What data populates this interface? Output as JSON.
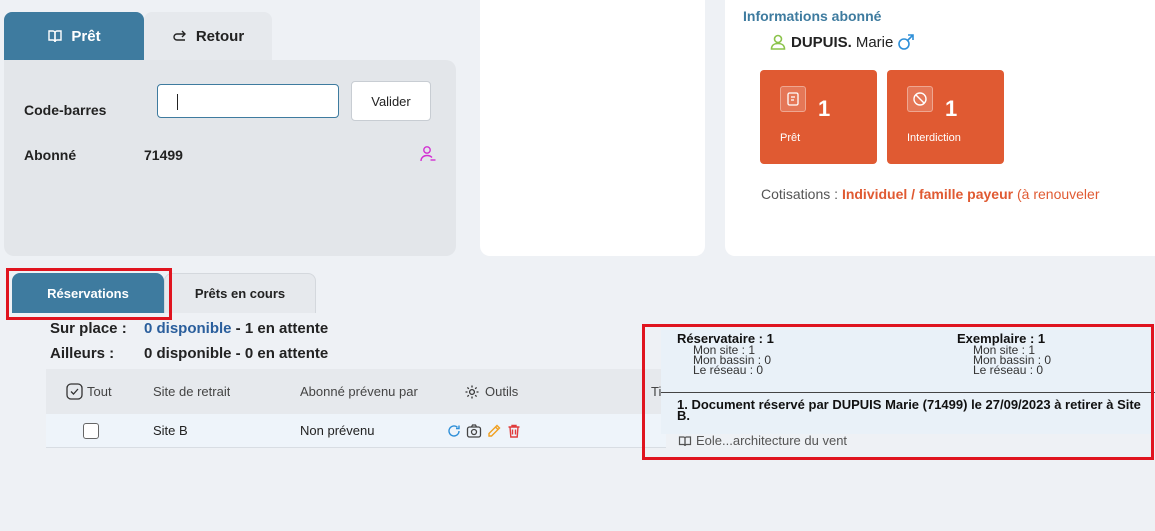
{
  "pret": {
    "tab_pret": "Prêt",
    "tab_retour": "Retour",
    "barcode_label": "Code-barres",
    "barcode_value": "",
    "validate_label": "Valider",
    "abonne_label": "Abonné",
    "abonne_value": "71499"
  },
  "abonne": {
    "title": "Informations abonné",
    "nom": "DUPUIS.",
    "prenom": "Marie",
    "cards": [
      {
        "count": "1",
        "label": "Prêt",
        "icon": "loan-doc-icon"
      },
      {
        "count": "1",
        "label": "Interdiction",
        "icon": "prohibited-icon"
      }
    ],
    "cotisations_label": "Cotisations :",
    "cotisation_type": "Individuel / famille payeur",
    "cotisation_note": "(à renouveler"
  },
  "tabs": {
    "reservations": "Réservations",
    "prets_en_cours": "Prêts en cours"
  },
  "summary": {
    "sur_place_label": "Sur place :",
    "sur_place_disponible": "0 disponible",
    "sur_place_rest": " - 1 en attente",
    "ailleurs_label": "Ailleurs :",
    "ailleurs_value": "0 disponible - 0 en attente"
  },
  "table": {
    "headers": {
      "tout": "Tout",
      "site": "Site de retrait",
      "abonne_prevenu": "Abonné prévenu par",
      "outils": "Outils",
      "titre": "Ti"
    },
    "rows": [
      {
        "site": "Site B",
        "prevenu": "Non prévenu",
        "titre": "Eole...architecture du vent"
      }
    ]
  },
  "tooltip": {
    "reservataire_title": "Réservataire : 1",
    "reservataire_lines": [
      "Mon site : 1",
      "Mon bassin : 0",
      "Le réseau : 0"
    ],
    "exemplaire_title": "Exemplaire : 1",
    "exemplaire_lines": [
      "Mon site : 1",
      "Mon bassin : 0",
      "Le réseau : 0"
    ],
    "message": "1. Document réservé par DUPUIS Marie (71499) le 27/09/2023 à retirer à Site B."
  },
  "colors": {
    "primary": "#3e7b9f",
    "accent": "#e05a32",
    "highlight_border": "#e0141f",
    "link_blue": "#2a5e9c"
  }
}
